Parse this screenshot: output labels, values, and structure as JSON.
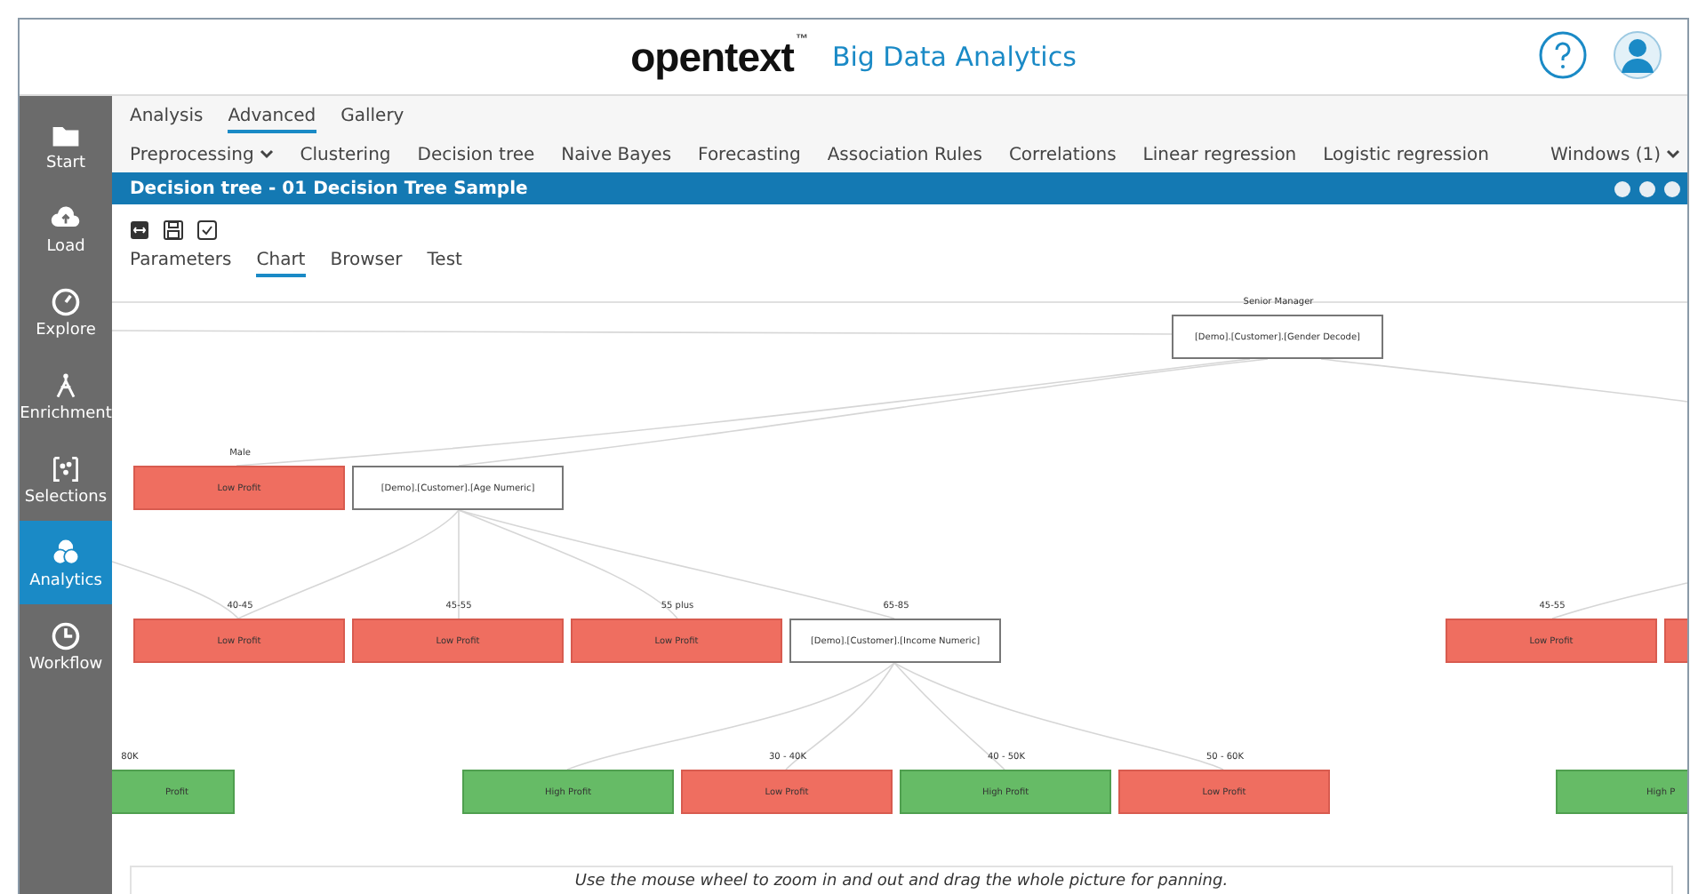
{
  "header": {
    "logo": "opentext",
    "trademark": "™",
    "product": "Big Data Analytics"
  },
  "sidebar": {
    "items": [
      {
        "label": "Start",
        "selected": false
      },
      {
        "label": "Load",
        "selected": false
      },
      {
        "label": "Explore",
        "selected": false
      },
      {
        "label": "Enrichment",
        "selected": false
      },
      {
        "label": "Selections",
        "selected": false
      },
      {
        "label": "Analytics",
        "selected": true
      },
      {
        "label": "Workflow",
        "selected": false
      }
    ]
  },
  "top_tabs": [
    {
      "label": "Analysis",
      "selected": false
    },
    {
      "label": "Advanced",
      "selected": true
    },
    {
      "label": "Gallery",
      "selected": false
    }
  ],
  "menu": {
    "items": [
      {
        "label": "Preprocessing",
        "dropdown": true
      },
      {
        "label": "Clustering",
        "dropdown": false
      },
      {
        "label": "Decision tree",
        "dropdown": false
      },
      {
        "label": "Naive Bayes",
        "dropdown": false
      },
      {
        "label": "Forecasting",
        "dropdown": false
      },
      {
        "label": "Association Rules",
        "dropdown": false
      },
      {
        "label": "Correlations",
        "dropdown": false
      },
      {
        "label": "Linear regression",
        "dropdown": false
      },
      {
        "label": "Logistic regression",
        "dropdown": false
      }
    ],
    "windows": "Windows (1)"
  },
  "panel": {
    "title": "Decision tree - 01 Decision Tree Sample"
  },
  "view_tabs": [
    {
      "label": "Parameters",
      "selected": false
    },
    {
      "label": "Chart",
      "selected": true
    },
    {
      "label": "Browser",
      "selected": false
    },
    {
      "label": "Test",
      "selected": false
    }
  ],
  "tree": {
    "nodes": [
      {
        "kind": "split",
        "label": "Senior Manager",
        "text": "[Demo].[Customer].[Gender Decode]"
      },
      {
        "kind": "low",
        "label": "Male",
        "text": "Low Profit"
      },
      {
        "kind": "split",
        "text": "[Demo].[Customer].[Age Numeric]"
      },
      {
        "kind": "low",
        "label": "40-45",
        "text": "Low Profit"
      },
      {
        "kind": "low",
        "label": "45-55",
        "text": "Low Profit"
      },
      {
        "kind": "low",
        "label": "55 plus",
        "text": "Low Profit"
      },
      {
        "kind": "split",
        "label": "65-85",
        "text": "[Demo].[Customer].[Income Numeric]"
      },
      {
        "kind": "low",
        "label": "45-55",
        "text": "Low Profit"
      },
      {
        "kind": "low"
      },
      {
        "kind": "high",
        "label": "80K",
        "text": "Profit"
      },
      {
        "kind": "high",
        "text": "High Profit"
      },
      {
        "kind": "low",
        "label": "30 - 40K",
        "text": "Low Profit"
      },
      {
        "kind": "high",
        "label": "40 - 50K",
        "text": "High Profit"
      },
      {
        "kind": "low",
        "label": "50 - 60K",
        "text": "Low Profit"
      },
      {
        "kind": "high",
        "text": "High P"
      }
    ]
  },
  "hint": "Use the mouse wheel to zoom in and out and drag the whole picture for panning."
}
